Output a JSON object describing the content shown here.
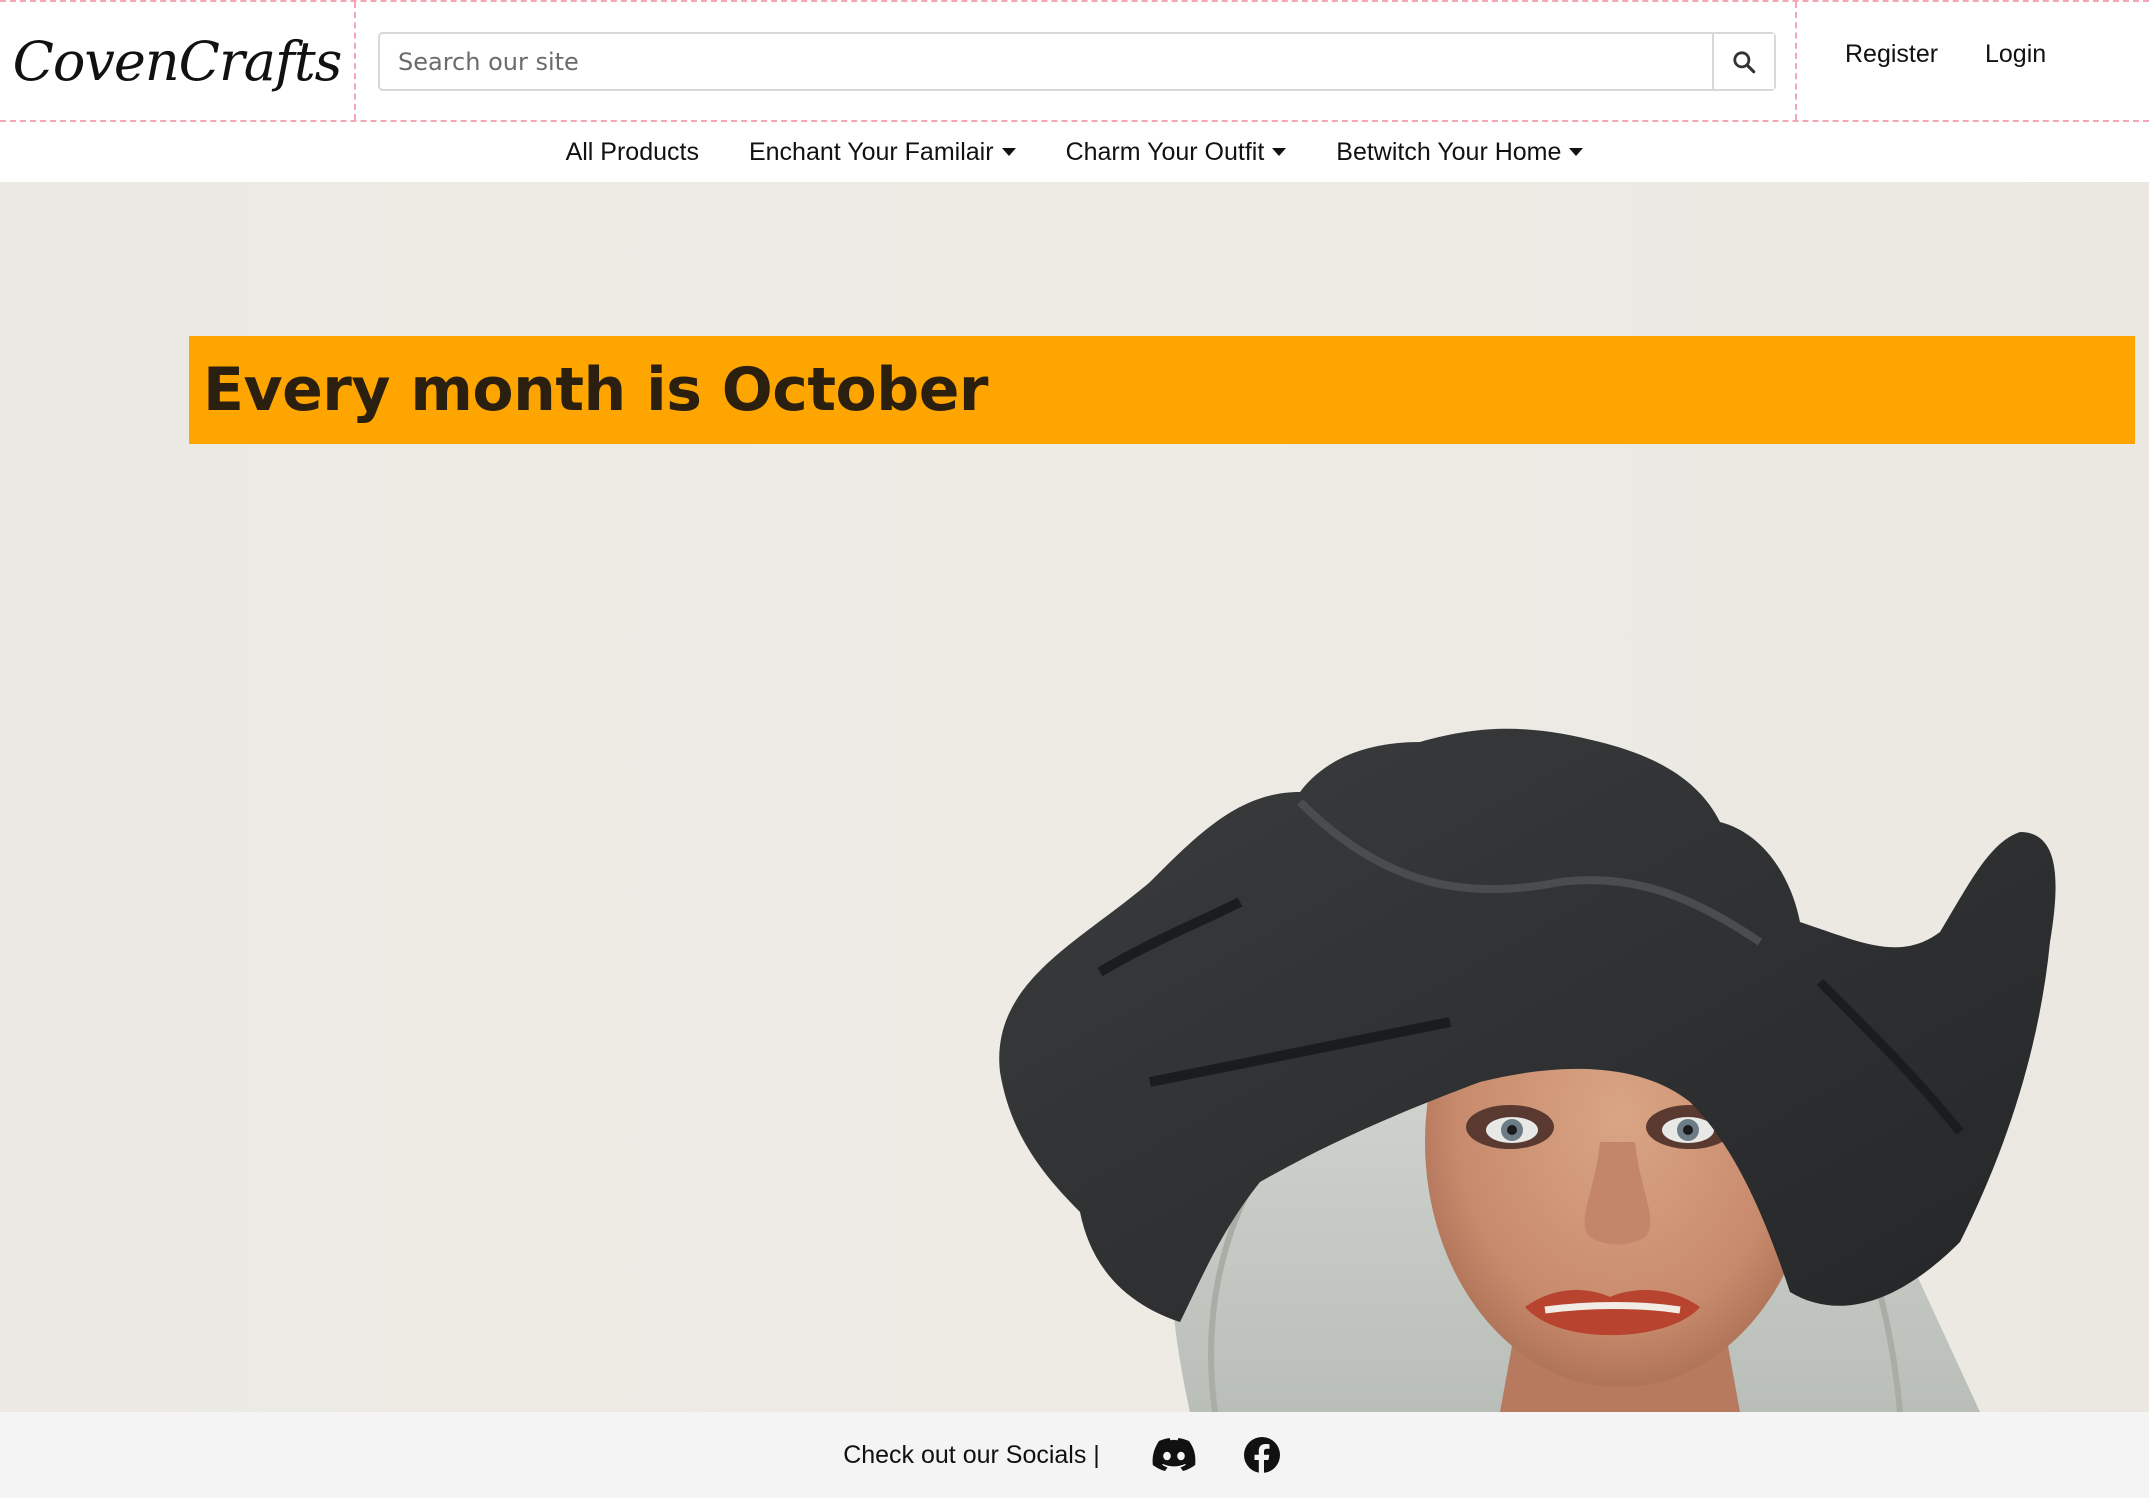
{
  "header": {
    "logo_text": "CovenCrafts",
    "search": {
      "placeholder": "Search our site",
      "value": ""
    },
    "search_icon": "search-icon",
    "register_label": "Register",
    "login_label": "Login"
  },
  "nav": {
    "items": [
      {
        "label": "All Products",
        "dropdown": false
      },
      {
        "label": "Enchant Your Familair",
        "dropdown": true
      },
      {
        "label": "Charm Your Outfit",
        "dropdown": true
      },
      {
        "label": "Betwitch Your Home",
        "dropdown": true
      }
    ]
  },
  "hero": {
    "headline": "Every month is October",
    "banner_color": "#ffa500"
  },
  "footer": {
    "text": "Check out our Socials |",
    "socials": [
      {
        "icon": "discord-icon"
      },
      {
        "icon": "facebook-icon"
      }
    ]
  }
}
